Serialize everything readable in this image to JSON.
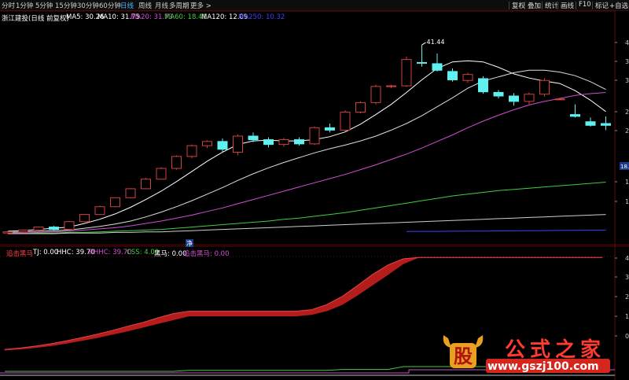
{
  "toolbar": {
    "timeframes": [
      "分时",
      "1分钟",
      "5分钟",
      "15分钟",
      "30分钟",
      "60分钟",
      "日线",
      "周线",
      "月线",
      "多周期",
      "更多 >"
    ],
    "active_timeframe": "日线",
    "buttons": [
      "复权",
      "叠加",
      "统计",
      "画线",
      "F10",
      "标记",
      "+自选"
    ]
  },
  "main_panel": {
    "stock_name": "浙江建投(日线 前复权)",
    "indicators": [
      {
        "label": "MA5: 30.26",
        "color": "#ffffff"
      },
      {
        "label": "MA10: 31.75",
        "color": "#ffffff"
      },
      {
        "label": "MA20: 31.73",
        "color": "#d04fd0"
      },
      {
        "label": "MA60: 18.41",
        "color": "#3fcf3f"
      },
      {
        "label": "MA120: 12.09",
        "color": "#ffffff"
      },
      {
        "label": "MA250: 10.32",
        "color": "#3f3fff"
      }
    ],
    "high_annotation": "41.44",
    "right_price_label": "18.1",
    "y_tick_labels": [
      "4",
      "3",
      "3",
      "2",
      "2",
      "1",
      "1"
    ],
    "marker": "净"
  },
  "sub_panel": {
    "indicators": [
      {
        "label": "追击黑马",
        "color": "#ff4040"
      },
      {
        "label": "TJ: 0.00",
        "color": "#ffffff"
      },
      {
        "label": "HHC: 39.70",
        "color": "#ffffff"
      },
      {
        "label": "RHHC: 39.70",
        "color": "#d04fd0"
      },
      {
        "label": "CSS: 4.00",
        "color": "#3fcf3f"
      },
      {
        "label": "黑马: 0.00",
        "color": "#ffffff"
      },
      {
        "label": "追击黑马: 0.00",
        "color": "#d04fd0"
      }
    ],
    "y_tick_labels": [
      "4",
      "3",
      "2",
      "1",
      "0"
    ]
  },
  "watermark": {
    "logo_text": "股",
    "title": "公式之家",
    "url": "www.gszj100.com"
  },
  "colors": {
    "up": "#d04040",
    "down": "#5ff0f0",
    "ma5": "#ffffff",
    "ma20": "#d04fd0",
    "ma60": "#3fcf3f",
    "ma250": "#3f3fff",
    "band": "#b51c1c",
    "grid": "#5a0a0a"
  },
  "chart_data": {
    "type": "candlestick",
    "candles": [
      {
        "o": 10.0,
        "h": 10.3,
        "l": 9.9,
        "c": 10.2
      },
      {
        "o": 10.2,
        "h": 10.6,
        "l": 10.1,
        "c": 10.5
      },
      {
        "o": 10.5,
        "h": 11.1,
        "l": 10.3,
        "c": 11.0
      },
      {
        "o": 11.0,
        "h": 11.2,
        "l": 10.4,
        "c": 10.6
      },
      {
        "o": 10.6,
        "h": 12.0,
        "l": 10.5,
        "c": 11.9
      },
      {
        "o": 11.9,
        "h": 13.2,
        "l": 11.8,
        "c": 13.1
      },
      {
        "o": 13.1,
        "h": 14.6,
        "l": 13.0,
        "c": 14.4
      },
      {
        "o": 14.4,
        "h": 16.0,
        "l": 14.3,
        "c": 15.9
      },
      {
        "o": 15.9,
        "h": 17.5,
        "l": 15.8,
        "c": 17.4
      },
      {
        "o": 17.4,
        "h": 19.2,
        "l": 17.3,
        "c": 19.0
      },
      {
        "o": 19.0,
        "h": 21.0,
        "l": 18.9,
        "c": 20.8
      },
      {
        "o": 20.8,
        "h": 23.0,
        "l": 20.6,
        "c": 22.8
      },
      {
        "o": 22.8,
        "h": 24.8,
        "l": 22.5,
        "c": 24.6
      },
      {
        "o": 24.6,
        "h": 25.5,
        "l": 24.2,
        "c": 25.3
      },
      {
        "o": 25.3,
        "h": 25.8,
        "l": 23.5,
        "c": 24.0
      },
      {
        "o": 23.5,
        "h": 26.5,
        "l": 23.0,
        "c": 26.2
      },
      {
        "o": 26.2,
        "h": 26.8,
        "l": 25.2,
        "c": 25.6
      },
      {
        "o": 25.6,
        "h": 26.0,
        "l": 24.3,
        "c": 24.8
      },
      {
        "o": 24.8,
        "h": 25.9,
        "l": 24.4,
        "c": 25.6
      },
      {
        "o": 25.6,
        "h": 26.0,
        "l": 24.6,
        "c": 24.9
      },
      {
        "o": 24.9,
        "h": 27.8,
        "l": 24.7,
        "c": 27.6
      },
      {
        "o": 27.6,
        "h": 28.3,
        "l": 26.8,
        "c": 27.2
      },
      {
        "o": 27.2,
        "h": 30.5,
        "l": 27.0,
        "c": 30.2
      },
      {
        "o": 30.2,
        "h": 32.0,
        "l": 30.0,
        "c": 31.8
      },
      {
        "o": 31.8,
        "h": 34.8,
        "l": 31.5,
        "c": 34.5
      },
      {
        "o": 34.5,
        "h": 34.8,
        "l": 34.2,
        "c": 34.6
      },
      {
        "o": 34.6,
        "h": 39.5,
        "l": 34.4,
        "c": 39.0
      },
      {
        "o": 38.5,
        "h": 41.44,
        "l": 37.8,
        "c": 38.4
      },
      {
        "o": 38.3,
        "h": 40.0,
        "l": 37.0,
        "c": 37.2
      },
      {
        "o": 37.0,
        "h": 37.5,
        "l": 35.3,
        "c": 35.6
      },
      {
        "o": 35.5,
        "h": 36.8,
        "l": 35.1,
        "c": 36.5
      },
      {
        "o": 35.8,
        "h": 36.2,
        "l": 33.3,
        "c": 33.6
      },
      {
        "o": 33.5,
        "h": 33.9,
        "l": 32.5,
        "c": 32.9
      },
      {
        "o": 32.9,
        "h": 33.4,
        "l": 31.3,
        "c": 32.0
      },
      {
        "o": 32.0,
        "h": 33.5,
        "l": 31.5,
        "c": 33.2
      },
      {
        "o": 33.2,
        "h": 35.9,
        "l": 32.8,
        "c": 35.5
      },
      {
        "o": 32.4,
        "h": 32.6,
        "l": 32.2,
        "c": 32.4
      },
      {
        "o": 29.8,
        "h": 31.5,
        "l": 29.3,
        "c": 29.5
      },
      {
        "o": 28.6,
        "h": 29.3,
        "l": 27.8,
        "c": 28.0
      },
      {
        "o": 28.3,
        "h": 29.5,
        "l": 27.2,
        "c": 28.0
      }
    ],
    "ma_series": [
      {
        "name": "MA5",
        "values": [
          10.3,
          10.4,
          10.6,
          10.8,
          11.0,
          11.6,
          12.3,
          13.2,
          14.3,
          15.6,
          17.0,
          18.6,
          20.3,
          22.0,
          23.5,
          24.8,
          25.4,
          25.5,
          25.4,
          25.4,
          25.6,
          26.1,
          26.9,
          28.2,
          29.8,
          31.5,
          33.5,
          35.6,
          37.5,
          38.6,
          38.8,
          38.6,
          37.7,
          36.6,
          35.9,
          35.4,
          35.0,
          33.8,
          32.2,
          30.3
        ]
      },
      {
        "name": "MA10",
        "values": [
          10.1,
          10.2,
          10.3,
          10.4,
          10.5,
          10.8,
          11.1,
          11.5,
          12.0,
          12.7,
          13.5,
          14.4,
          15.4,
          16.5,
          17.6,
          18.8,
          19.9,
          20.9,
          21.8,
          22.6,
          23.4,
          24.1,
          24.7,
          25.4,
          26.2,
          27.2,
          28.3,
          29.6,
          31.1,
          32.6,
          34.2,
          35.4,
          36.1,
          36.8,
          37.2,
          37.2,
          36.9,
          36.3,
          35.3,
          34.0
        ]
      },
      {
        "name": "MA20",
        "values": [
          10.0,
          10.0,
          10.1,
          10.2,
          10.3,
          10.5,
          10.7,
          10.9,
          11.2,
          11.6,
          12.0,
          12.5,
          13.0,
          13.6,
          14.2,
          14.9,
          15.6,
          16.3,
          17.0,
          17.7,
          18.4,
          19.1,
          19.8,
          20.6,
          21.4,
          22.3,
          23.2,
          24.2,
          25.3,
          26.4,
          27.6,
          28.7,
          29.7,
          30.6,
          31.4,
          32.0,
          32.5,
          33.0,
          33.3,
          33.5
        ]
      },
      {
        "name": "MA60",
        "values": [
          9.9,
          9.9,
          10.0,
          10.0,
          10.1,
          10.1,
          10.2,
          10.3,
          10.4,
          10.5,
          10.6,
          10.8,
          11.0,
          11.2,
          11.4,
          11.6,
          11.8,
          12.0,
          12.3,
          12.5,
          12.8,
          13.1,
          13.4,
          13.8,
          14.2,
          14.6,
          15.0,
          15.4,
          15.8,
          16.2,
          16.5,
          16.8,
          17.1,
          17.3,
          17.5,
          17.7,
          17.9,
          18.1,
          18.3,
          18.5
        ]
      },
      {
        "name": "MA120",
        "values": [
          9.9,
          9.9,
          9.9,
          9.9,
          10.0,
          10.0,
          10.0,
          10.1,
          10.1,
          10.2,
          10.2,
          10.3,
          10.4,
          10.5,
          10.6,
          10.7,
          10.8,
          10.9,
          11.0,
          11.1,
          11.2,
          11.3,
          11.4,
          11.5,
          11.6,
          11.7,
          11.8,
          11.9,
          12.0,
          12.1,
          12.2,
          12.3,
          12.4,
          12.5,
          12.6,
          12.7,
          12.8,
          12.9,
          13.0,
          13.1
        ]
      },
      {
        "name": "MA250",
        "values": [
          null,
          null,
          null,
          null,
          null,
          null,
          null,
          null,
          null,
          null,
          null,
          null,
          null,
          null,
          null,
          null,
          null,
          null,
          null,
          null,
          null,
          null,
          null,
          null,
          null,
          null,
          10.25,
          10.27,
          10.28,
          10.3,
          10.31,
          10.33,
          10.35,
          10.37,
          10.39,
          10.41,
          10.43,
          10.45,
          10.47,
          10.5
        ]
      }
    ],
    "sub_band": {
      "upper": [
        0.03,
        0.06,
        0.1,
        0.15,
        0.21,
        0.28,
        0.35,
        0.43,
        0.52,
        0.6,
        0.7,
        0.79,
        0.84,
        0.84,
        0.84,
        0.84,
        0.84,
        0.84,
        0.84,
        0.84,
        0.87,
        0.98,
        1.15,
        1.38,
        1.62,
        1.82,
        1.95,
        1.98,
        1.98,
        1.98,
        1.98,
        1.98,
        1.98,
        1.98,
        1.98,
        1.98,
        1.98,
        1.98,
        1.98,
        1.98
      ],
      "lower": [
        0.02,
        0.04,
        0.07,
        0.11,
        0.16,
        0.22,
        0.28,
        0.35,
        0.42,
        0.5,
        0.58,
        0.66,
        0.74,
        0.74,
        0.74,
        0.74,
        0.74,
        0.74,
        0.74,
        0.74,
        0.77,
        0.85,
        0.98,
        1.18,
        1.4,
        1.62,
        1.85,
        1.98,
        1.98,
        1.98,
        1.98,
        1.98,
        1.98,
        1.98,
        1.98,
        1.98,
        1.98,
        1.98,
        1.98,
        1.98
      ]
    },
    "sub_css": [
      0.05,
      0.05,
      0.05,
      0.05,
      0.05,
      0.05,
      0.05,
      0.05,
      0.05,
      0.05,
      0.05,
      0.05,
      0.06,
      0.06,
      0.06,
      0.06,
      0.06,
      0.06,
      0.06,
      0.06,
      0.06,
      0.06,
      0.07,
      0.07,
      0.07,
      0.07,
      0.1,
      0.1,
      0.1,
      0.1,
      0.1,
      0.1,
      0.1,
      0.1,
      0.1,
      0.1,
      0.1,
      0.1,
      0.1,
      0.1
    ]
  }
}
